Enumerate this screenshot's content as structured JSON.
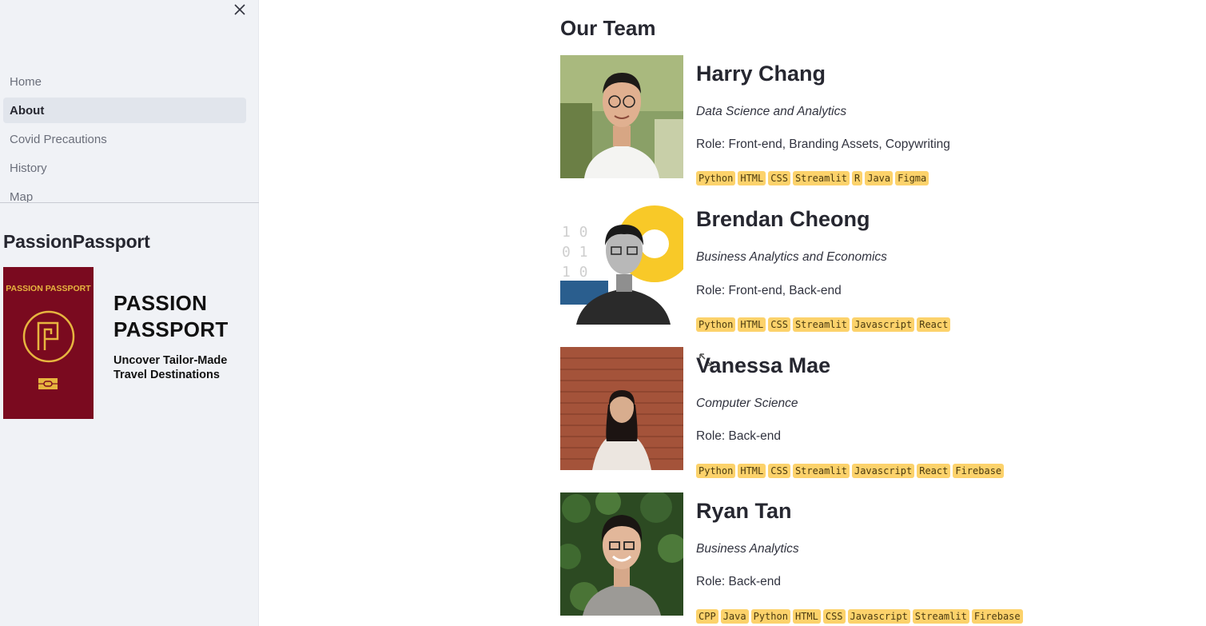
{
  "sidebar": {
    "close_label": "×",
    "nav_items": [
      {
        "label": "Home",
        "active": false
      },
      {
        "label": "About",
        "active": true
      },
      {
        "label": "Covid Precautions",
        "active": false
      },
      {
        "label": "History",
        "active": false
      },
      {
        "label": "Map",
        "active": false
      }
    ],
    "brand_title": "PassionPassport",
    "logo": {
      "passport_text": "PASSION PASSPORT",
      "wordmark": "PASSION PASSPORT",
      "tagline": "Uncover Tailor-Made Travel Destinations"
    }
  },
  "main": {
    "heading": "Our Team",
    "members": [
      {
        "name": "Harry Chang",
        "dept": "Data Science and Analytics",
        "role": "Role: Front-end, Branding Assets, Copywriting",
        "tags": [
          "Python",
          "HTML",
          "CSS",
          "Streamlit",
          "R",
          "Java",
          "Figma"
        ]
      },
      {
        "name": "Brendan Cheong",
        "dept": "Business Analytics and Economics",
        "role": "Role: Front-end, Back-end",
        "tags": [
          "Python",
          "HTML",
          "CSS",
          "Streamlit",
          "Javascript",
          "React"
        ]
      },
      {
        "name": "Vanessa Mae",
        "dept": "Computer Science",
        "role": "Role: Back-end",
        "tags": [
          "Python",
          "HTML",
          "CSS",
          "Streamlit",
          "Javascript",
          "React",
          "Firebase"
        ]
      },
      {
        "name": "Ryan Tan",
        "dept": "Business Analytics",
        "role": "Role: Back-end",
        "tags": [
          "CPP",
          "Java",
          "Python",
          "HTML",
          "CSS",
          "Javascript",
          "Streamlit",
          "Firebase"
        ]
      }
    ]
  },
  "colors": {
    "sidebar_bg": "#f0f2f6",
    "tag_bg": "#fcd26b",
    "passport_red": "#7a0a1f",
    "passport_gold": "#e7b53f"
  }
}
